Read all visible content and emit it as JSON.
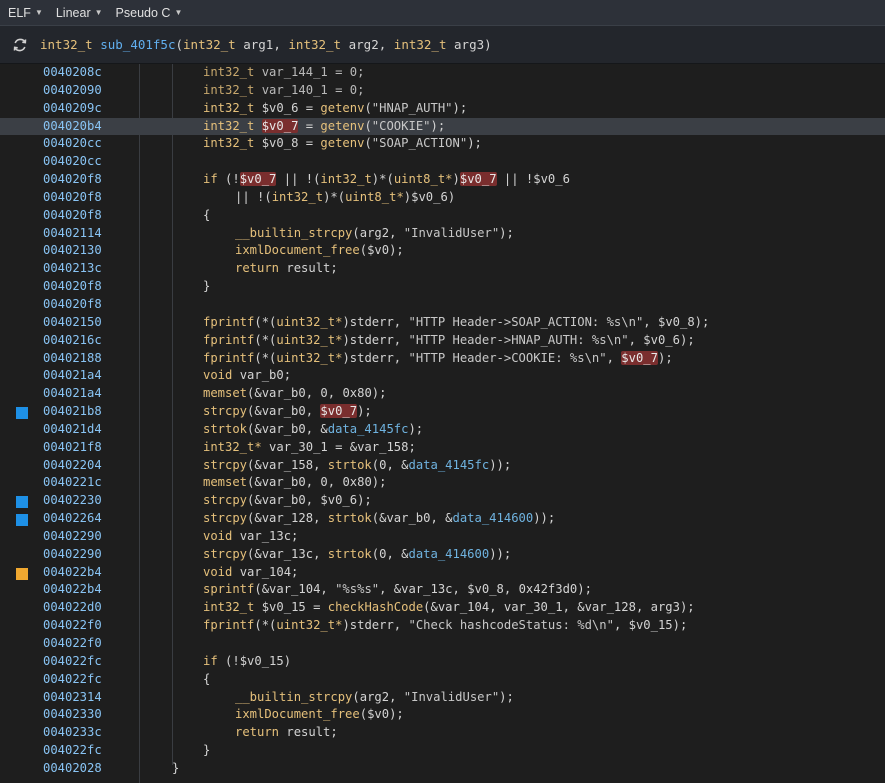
{
  "menubar": {
    "items": [
      "ELF",
      "Linear",
      "Pseudo C"
    ]
  },
  "function_header": {
    "return_type": "int32_t",
    "name": "sub_401f5c",
    "params": [
      {
        "type": "int32_t",
        "name": "arg1"
      },
      {
        "type": "int32_t",
        "name": "arg2"
      },
      {
        "type": "int32_t",
        "name": "arg3"
      }
    ]
  },
  "colors": {
    "marker_blue": "#1e90e6",
    "marker_orange": "#f0a830",
    "highlight_var": "#7a2e2e"
  },
  "lines": [
    {
      "addr": "0040208c",
      "indent": 0,
      "code": "int32_t var_144_1 = 0;",
      "dim": true
    },
    {
      "addr": "00402090",
      "indent": 0,
      "code": "int32_t var_140_1 = 0;",
      "dim": true
    },
    {
      "addr": "0040209c",
      "indent": 0,
      "code": "int32_t $v0_6 = getenv(\"HNAP_AUTH\");"
    },
    {
      "addr": "004020b4",
      "indent": 0,
      "code": "int32_t $v0_7 = getenv(\"COOKIE\");",
      "highlight_row": true
    },
    {
      "addr": "004020cc",
      "indent": 0,
      "code": "int32_t $v0_8 = getenv(\"SOAP_ACTION\");"
    },
    {
      "addr": "004020cc",
      "indent": 0,
      "code": ""
    },
    {
      "addr": "004020f8",
      "indent": 0,
      "code": "if (!$v0_7 || !(int32_t)*(uint8_t*)$v0_7 || !$v0_6"
    },
    {
      "addr": "004020f8",
      "indent": 1,
      "code": "|| !(int32_t)*(uint8_t*)$v0_6)"
    },
    {
      "addr": "004020f8",
      "indent": 0,
      "code": "{"
    },
    {
      "addr": "00402114",
      "indent": 1,
      "code": "__builtin_strcpy(arg2, \"InvalidUser\");"
    },
    {
      "addr": "00402130",
      "indent": 1,
      "code": "ixmlDocument_free($v0);"
    },
    {
      "addr": "0040213c",
      "indent": 1,
      "code": "return result;"
    },
    {
      "addr": "004020f8",
      "indent": 0,
      "code": "}"
    },
    {
      "addr": "004020f8",
      "indent": 0,
      "code": ""
    },
    {
      "addr": "00402150",
      "indent": 0,
      "code": "fprintf(*(uint32_t*)stderr, \"HTTP Header->SOAP_ACTION: %s\\n\", $v0_8);"
    },
    {
      "addr": "0040216c",
      "indent": 0,
      "code": "fprintf(*(uint32_t*)stderr, \"HTTP Header->HNAP_AUTH: %s\\n\", $v0_6);"
    },
    {
      "addr": "00402188",
      "indent": 0,
      "code": "fprintf(*(uint32_t*)stderr, \"HTTP Header->COOKIE: %s\\n\", $v0_7);"
    },
    {
      "addr": "004021a4",
      "indent": 0,
      "code": "void var_b0;"
    },
    {
      "addr": "004021a4",
      "indent": 0,
      "code": "memset(&var_b0, 0, 0x80);"
    },
    {
      "addr": "004021b8",
      "indent": 0,
      "code": "strcpy(&var_b0, $v0_7);",
      "marker": "blue"
    },
    {
      "addr": "004021d4",
      "indent": 0,
      "code": "strtok(&var_b0, &data_4145fc);"
    },
    {
      "addr": "004021f8",
      "indent": 0,
      "code": "int32_t* var_30_1 = &var_158;"
    },
    {
      "addr": "00402204",
      "indent": 0,
      "code": "strcpy(&var_158, strtok(0, &data_4145fc));"
    },
    {
      "addr": "0040221c",
      "indent": 0,
      "code": "memset(&var_b0, 0, 0x80);"
    },
    {
      "addr": "00402230",
      "indent": 0,
      "code": "strcpy(&var_b0, $v0_6);",
      "marker": "blue"
    },
    {
      "addr": "00402264",
      "indent": 0,
      "code": "strcpy(&var_128, strtok(&var_b0, &data_414600));",
      "marker": "blue"
    },
    {
      "addr": "00402290",
      "indent": 0,
      "code": "void var_13c;"
    },
    {
      "addr": "00402290",
      "indent": 0,
      "code": "strcpy(&var_13c, strtok(0, &data_414600));"
    },
    {
      "addr": "004022b4",
      "indent": 0,
      "code": "void var_104;",
      "marker": "orange"
    },
    {
      "addr": "004022b4",
      "indent": 0,
      "code": "sprintf(&var_104, \"%s%s\", &var_13c, $v0_8, 0x42f3d0);"
    },
    {
      "addr": "004022d0",
      "indent": 0,
      "code": "int32_t $v0_15 = checkHashCode(&var_104, var_30_1, &var_128, arg3);"
    },
    {
      "addr": "004022f0",
      "indent": 0,
      "code": "fprintf(*(uint32_t*)stderr, \"Check hashcodeStatus: %d\\n\", $v0_15);"
    },
    {
      "addr": "004022f0",
      "indent": 0,
      "code": ""
    },
    {
      "addr": "004022fc",
      "indent": 0,
      "code": "if (!$v0_15)"
    },
    {
      "addr": "004022fc",
      "indent": 0,
      "code": "{"
    },
    {
      "addr": "00402314",
      "indent": 1,
      "code": "__builtin_strcpy(arg2, \"InvalidUser\");"
    },
    {
      "addr": "00402330",
      "indent": 1,
      "code": "ixmlDocument_free($v0);"
    },
    {
      "addr": "0040233c",
      "indent": 1,
      "code": "return result;"
    },
    {
      "addr": "004022fc",
      "indent": 0,
      "code": "}"
    },
    {
      "addr": "00402028",
      "indent": -1,
      "code": "}"
    }
  ]
}
